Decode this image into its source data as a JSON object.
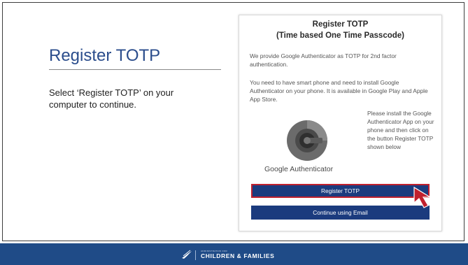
{
  "slide": {
    "title": "Register TOTP",
    "instruction": "Select ‘Register TOTP’ on your computer to continue."
  },
  "panel": {
    "heading_line1": "Register TOTP",
    "heading_line2": "(Time based One Time Passcode)",
    "para1": "We provide Google Authenticator as TOTP for 2nd factor authentication.",
    "para2": "You need to have smart phone and need to install Google Authenticator on your phone. It is available in Google Play and Apple App Store.",
    "logo_label": "Google Authenticator",
    "side_note": "Please install the Google Authenticator App on your phone and then click on the button Register TOTP shown below",
    "register_button": "Register TOTP",
    "email_button": "Continue using Email"
  },
  "footer": {
    "agency_small": "ADMINISTRATION FOR",
    "agency_name": "CHILDREN & FAMILIES"
  },
  "colors": {
    "title_blue": "#2b4d8c",
    "button_blue": "#1b3b7e",
    "highlight_red": "#c0202e",
    "footer_blue": "#1f4b87"
  },
  "icons": [
    "google-authenticator-logo",
    "mouse-cursor-icon",
    "hhs-eagle-logo"
  ]
}
